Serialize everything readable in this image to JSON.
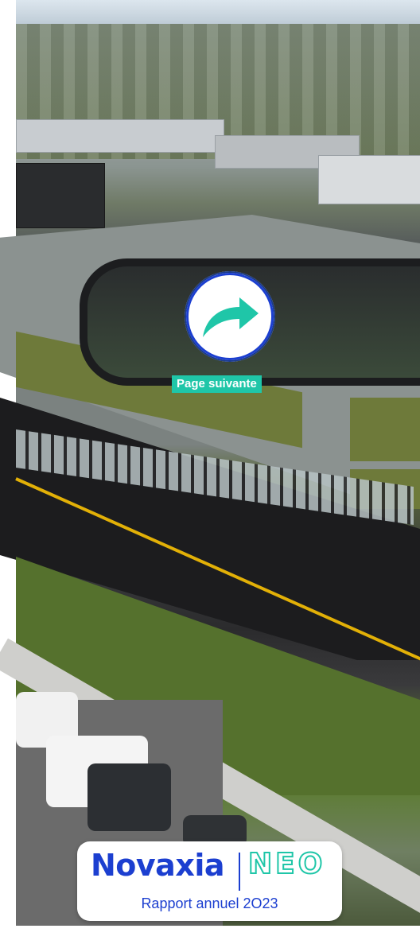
{
  "next_page": {
    "label": "Page suivante",
    "icon": "arrow-forward-icon"
  },
  "brand": {
    "name": "Novaxia",
    "sub_brand": "NEO",
    "subtitle": "Rapport annuel 2O23"
  },
  "colors": {
    "brand_blue": "#1c3fd0",
    "accent_teal": "#1fc6a8",
    "white": "#ffffff"
  }
}
